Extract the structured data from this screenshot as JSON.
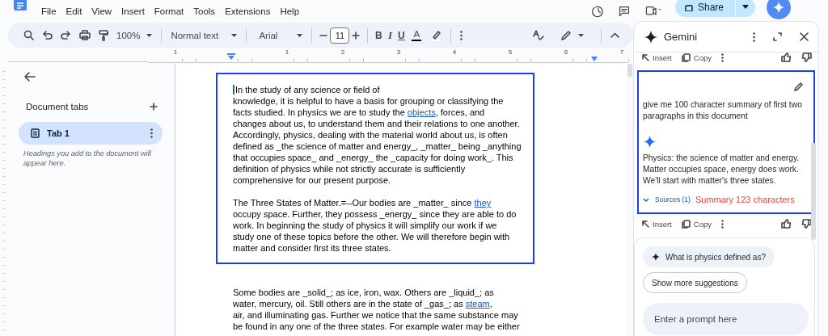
{
  "menu": [
    "File",
    "Edit",
    "View",
    "Insert",
    "Format",
    "Tools",
    "Extensions",
    "Help"
  ],
  "header": {
    "share_label": "Share"
  },
  "toolbar": {
    "zoom": "100%",
    "style": "Normal text",
    "font": "Arial",
    "font_size": "11",
    "bold": "B",
    "italic": "I",
    "underline": "U",
    "text_color": "A"
  },
  "ruler": {
    "labels": [
      "1",
      "1",
      "2",
      "3",
      "4",
      "5",
      "6",
      "7"
    ]
  },
  "sidebar": {
    "heading": "Document tabs",
    "tabs": [
      {
        "label": "Tab 1",
        "selected": true
      }
    ],
    "hint": "Headings you add to the document will appear here."
  },
  "document": {
    "blocks": [
      {
        "framed": true,
        "paragraphs": [
          [
            "In the study of any science or field of",
            "knowledge, it is helpful to have a basis for grouping or classifying the",
            [
              {
                "text": "facts studied. In physics we are to study the "
              },
              {
                "text": "objects",
                "link": true
              },
              {
                "text": ", forces, and"
              }
            ],
            "changes about us, to understand them and their relations to one another.",
            "Accordingly, physics, dealing with the material world about us, is often",
            "defined as _the science of matter and energy_, _matter_ being _anything",
            "that occupies space_ and _energy_ the _capacity for doing work_. This",
            "definition of physics while not strictly accurate is sufficiently",
            "comprehensive for our present purpose."
          ],
          [
            [
              {
                "text": "The Three States of Matter.=--Our bodies are _matter_ since "
              },
              {
                "text": "they",
                "link": true
              }
            ],
            "occupy space. Further, they possess _energy_ since they are able to do",
            "work. In beginning the study of physics it will simplify our work if we",
            "study one of these topics before the other. We will therefore begin with",
            "matter and consider first its three states."
          ]
        ]
      },
      {
        "framed": false,
        "paragraphs": [
          [
            "Some bodies are _solid_; as ice, iron, wax. Others are _liquid_; as",
            [
              {
                "text": "water, mercury, oil. Still others are in the state of _gas_; as "
              },
              {
                "text": "steam",
                "link": true
              },
              {
                "text": ","
              }
            ],
            "air, and illuminating gas. Further we notice that the same substance may",
            "be found in any one of the three states. For example water may be either"
          ]
        ]
      }
    ]
  },
  "gemini": {
    "title": "Gemini",
    "top_actions": {
      "insert": "Insert",
      "copy": "Copy"
    },
    "framed": true,
    "prompt": [
      "give me 100 character summary of first two",
      "paragraphs in this document"
    ],
    "response": [
      "Physics: the science of matter and energy.",
      "Matter occupies space, energy does work.",
      "We'll start with matter's three states."
    ],
    "sources": "Sources (1)",
    "annotation": "Summary 123 characters",
    "bottom_actions": {
      "insert": "Insert",
      "copy": "Copy"
    },
    "suggestion": "What is physics defined as?",
    "more_suggestions": "Show more suggestions",
    "input": {
      "placeholder": "Enter a prompt here"
    }
  }
}
